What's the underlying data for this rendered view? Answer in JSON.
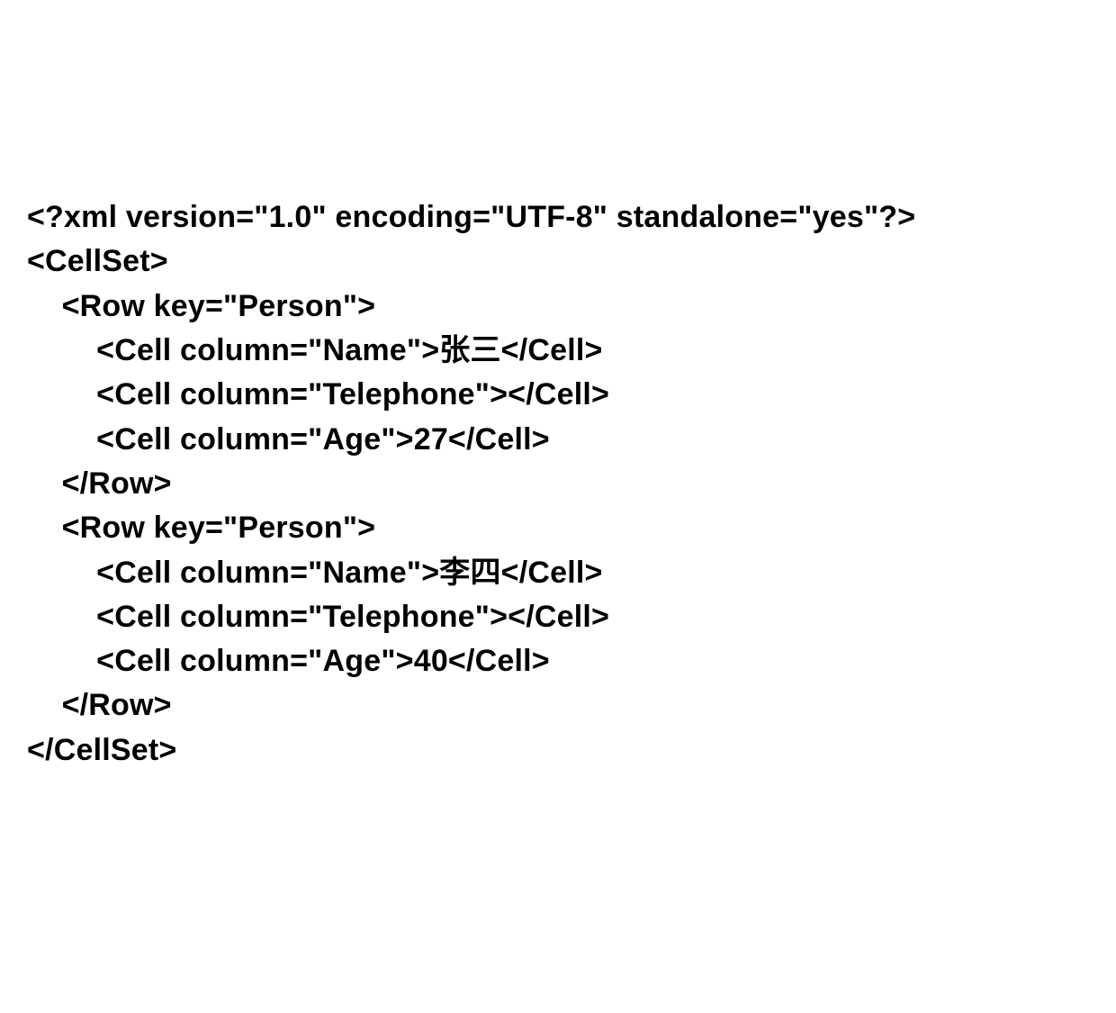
{
  "xml": {
    "declaration": "<?xml version=\"1.0\" encoding=\"UTF-8\" standalone=\"yes\"?>",
    "root_open": "<CellSet>",
    "root_close": "</CellSet>",
    "rows": [
      {
        "open": "<Row key=\"Person\">",
        "close": "</Row>",
        "cells": [
          {
            "text": "<Cell column=\"Name\">张三</Cell>"
          },
          {
            "text": "<Cell column=\"Telephone\"></Cell>"
          },
          {
            "text": "<Cell column=\"Age\">27</Cell>"
          }
        ]
      },
      {
        "open": "<Row key=\"Person\">",
        "close": "</Row>",
        "cells": [
          {
            "text": "<Cell column=\"Name\">李四</Cell>"
          },
          {
            "text": "<Cell column=\"Telephone\"></Cell>"
          },
          {
            "text": "<Cell column=\"Age\">40</Cell>"
          }
        ]
      }
    ]
  }
}
